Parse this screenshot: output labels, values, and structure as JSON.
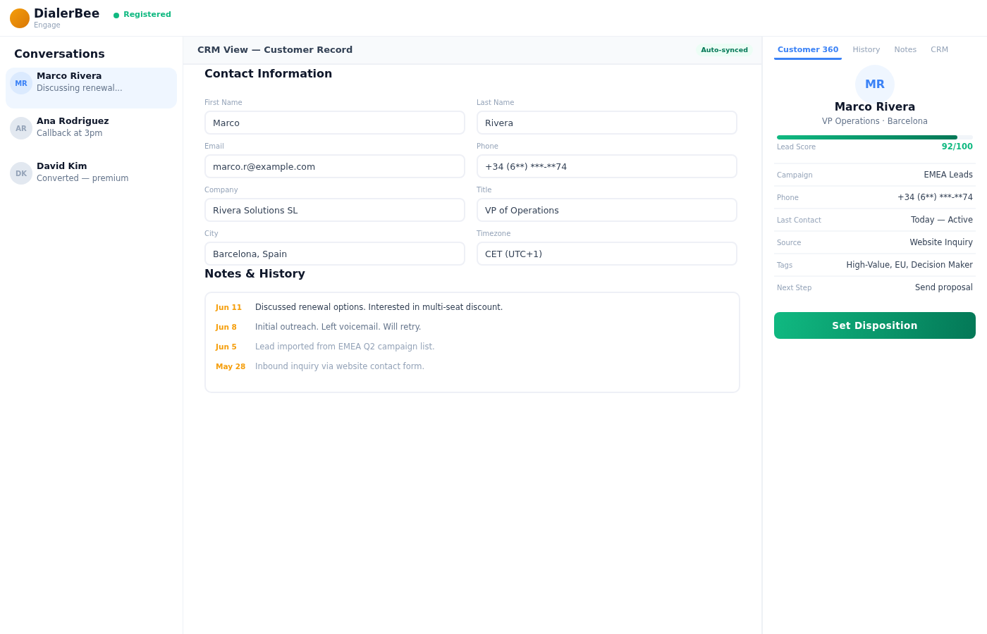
{
  "app": {
    "name": "DialerBee",
    "subtitle": "Engage",
    "status": {
      "label": "Registered",
      "registered": true
    }
  },
  "sidebar": {
    "title": "Conversations",
    "items": [
      {
        "initials": "MR",
        "name": "Marco Rivera",
        "preview": "Discussing renewal...",
        "selected": true
      },
      {
        "initials": "AR",
        "name": "Ana Rodriguez",
        "preview": "Callback at 3pm",
        "selected": false
      },
      {
        "initials": "DK",
        "name": "David Kim",
        "preview": "Converted — premium",
        "selected": false
      }
    ]
  },
  "crm": {
    "title": "CRM View — Customer Record",
    "badge": "Auto-synced",
    "contact": {
      "heading": "Contact Information",
      "fields": [
        {
          "label": "First Name",
          "value": "Marco"
        },
        {
          "label": "Last Name",
          "value": "Rivera"
        },
        {
          "label": "Email",
          "value": "marco.r@example.com"
        },
        {
          "label": "Phone",
          "value": "+34 (6**) ***-**74"
        },
        {
          "label": "Company",
          "value": "Rivera Solutions SL"
        },
        {
          "label": "Title",
          "value": "VP of Operations"
        },
        {
          "label": "City",
          "value": "Barcelona, Spain"
        },
        {
          "label": "Timezone",
          "value": "CET (UTC+1)"
        }
      ]
    },
    "notes": {
      "heading": "Notes & History",
      "entries": [
        {
          "date": "Jun 11",
          "text": "Discussed renewal options. Interested in multi-seat discount.",
          "kind": "latest"
        },
        {
          "date": "Jun 8",
          "text": "Initial outreach. Left voicemail. Will retry.",
          "kind": "recent"
        },
        {
          "date": "Jun 5",
          "text": "Lead imported from EMEA Q2 campaign list.",
          "kind": "older"
        },
        {
          "date": "May 28",
          "text": "Inbound inquiry via website contact form.",
          "kind": "older"
        }
      ]
    }
  },
  "profile": {
    "tabs": [
      {
        "label": "Customer 360",
        "selected": true
      },
      {
        "label": "History",
        "selected": false
      },
      {
        "label": "Notes",
        "selected": false
      },
      {
        "label": "CRM",
        "selected": false
      }
    ],
    "initials": "MR",
    "name": "Marco Rivera",
    "subtitle": "VP Operations · Barcelona",
    "score": {
      "label": "Lead Score",
      "value": "92/100",
      "level": 0.92
    },
    "details": [
      {
        "label": "Campaign",
        "value": "EMEA Leads"
      },
      {
        "label": "Phone",
        "value": "+34 (6**) ***-**74"
      },
      {
        "label": "Last Contact",
        "value": "Today — Active"
      },
      {
        "label": "Source",
        "value": "Website Inquiry"
      },
      {
        "label": "Tags",
        "value": "High-Value, EU, Decision Maker"
      },
      {
        "label": "Next Step",
        "value": "Send proposal"
      }
    ],
    "action": "Set Disposition"
  }
}
